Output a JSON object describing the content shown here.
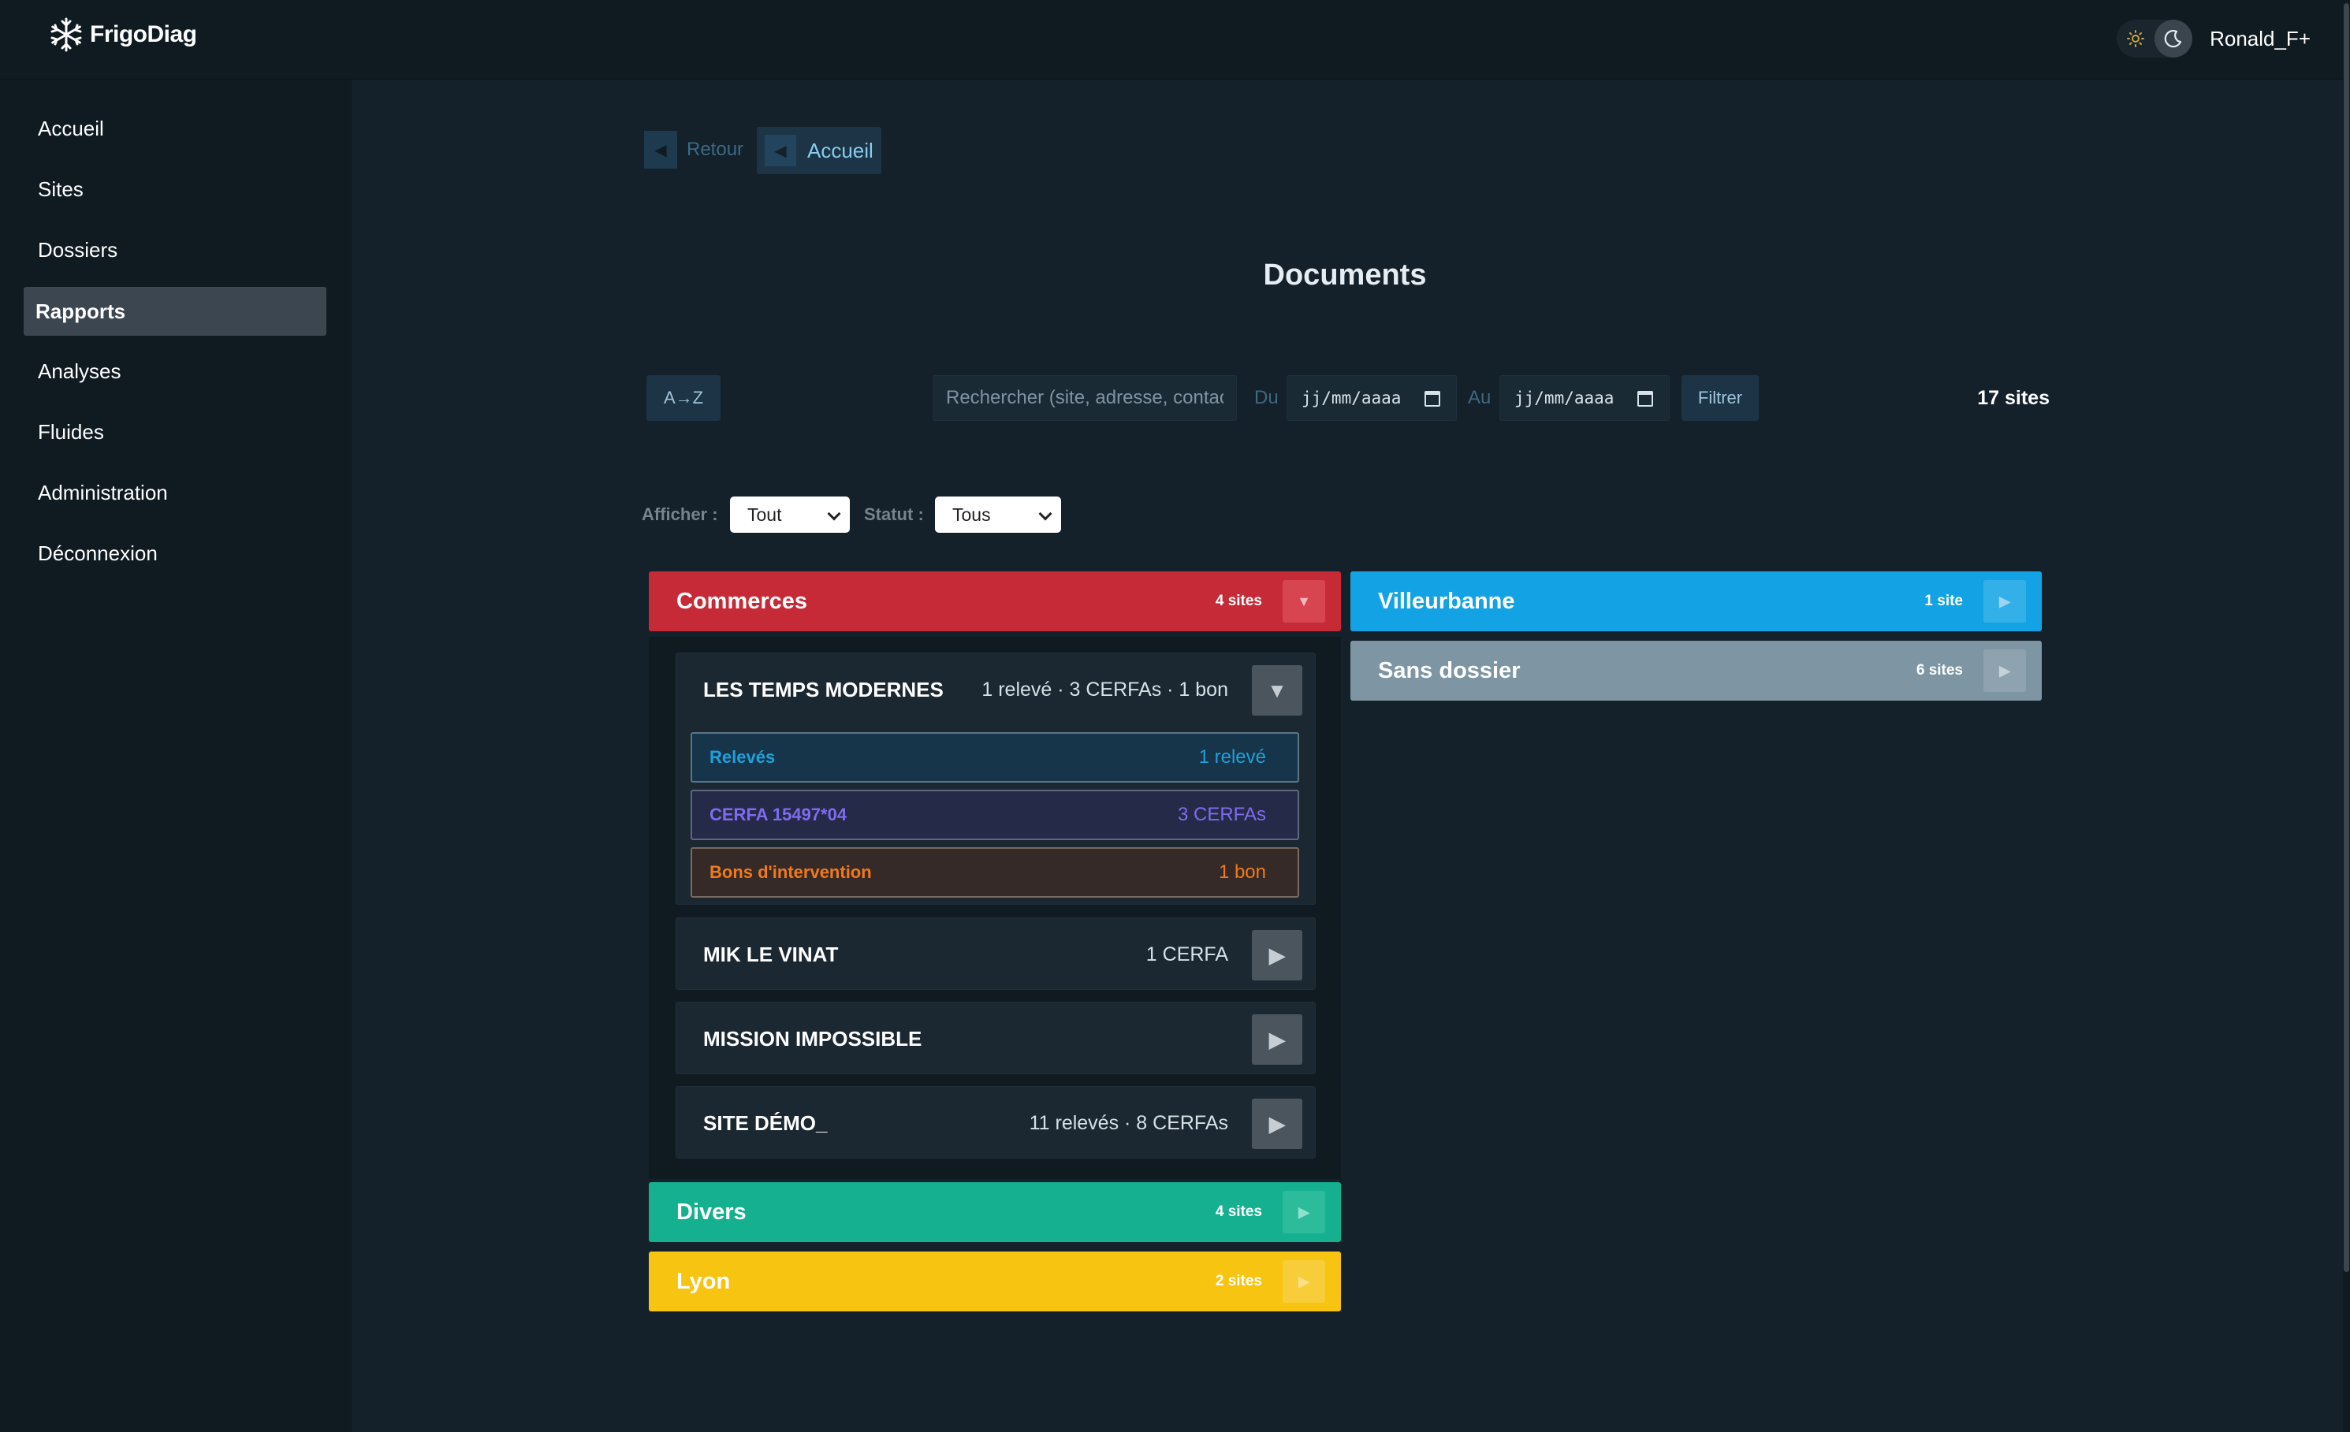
{
  "app": {
    "name": "FrigoDiag",
    "user": "Ronald_F+"
  },
  "sidebar": {
    "items": [
      {
        "label": "Accueil"
      },
      {
        "label": "Sites"
      },
      {
        "label": "Dossiers"
      },
      {
        "label": "Rapports",
        "active": true
      },
      {
        "label": "Analyses"
      },
      {
        "label": "Fluides"
      },
      {
        "label": "Administration"
      },
      {
        "label": "Déconnexion"
      }
    ]
  },
  "breadcrumb": {
    "back_label": "Retour",
    "home_label": "Accueil"
  },
  "page": {
    "title": "Documents"
  },
  "toolbar": {
    "sort_label": "A→Z",
    "search_placeholder": "Rechercher (site, adresse, contact…)",
    "date_from_label": "Du",
    "date_from_value": "jj/mm/aaaa",
    "date_to_label": "Au",
    "date_to_value": "jj/mm/aaaa",
    "filter_label": "Filtrer",
    "site_count": "17 sites"
  },
  "filters": {
    "display_label": "Afficher :",
    "display_value": "Tout",
    "status_label": "Statut :",
    "status_value": "Tous"
  },
  "groups": {
    "commerces": {
      "name": "Commerces",
      "count": "4 sites",
      "color": "#c62a36",
      "expanded": true,
      "sites": [
        {
          "name": "LES TEMPS MODERNES",
          "summary": "1 relevé · 3 CERFAs · 1 bon",
          "expanded": true,
          "docs": [
            {
              "label": "Relevés",
              "count": "1 relevé",
              "color": "#1fa0da"
            },
            {
              "label": "CERFA 15497*04",
              "count": "3 CERFAs",
              "color": "#7d6cf0"
            },
            {
              "label": "Bons d'intervention",
              "count": "1 bon",
              "color": "#f07a1a"
            }
          ]
        },
        {
          "name": "MIK LE VINAT",
          "summary": "1 CERFA"
        },
        {
          "name": "MISSION IMPOSSIBLE",
          "summary": ""
        },
        {
          "name": "SITE DÉMO_",
          "summary": "11 relevés · 8 CERFAs"
        }
      ]
    },
    "divers": {
      "name": "Divers",
      "count": "4 sites",
      "color": "#14b08f"
    },
    "lyon": {
      "name": "Lyon",
      "count": "2 sites",
      "color": "#f7c412"
    },
    "villeurbanne": {
      "name": "Villeurbanne",
      "count": "1 site",
      "color": "#13a3e4"
    },
    "sans_dossier": {
      "name": "Sans dossier",
      "count": "6 sites",
      "color": "#7e96a3"
    }
  }
}
